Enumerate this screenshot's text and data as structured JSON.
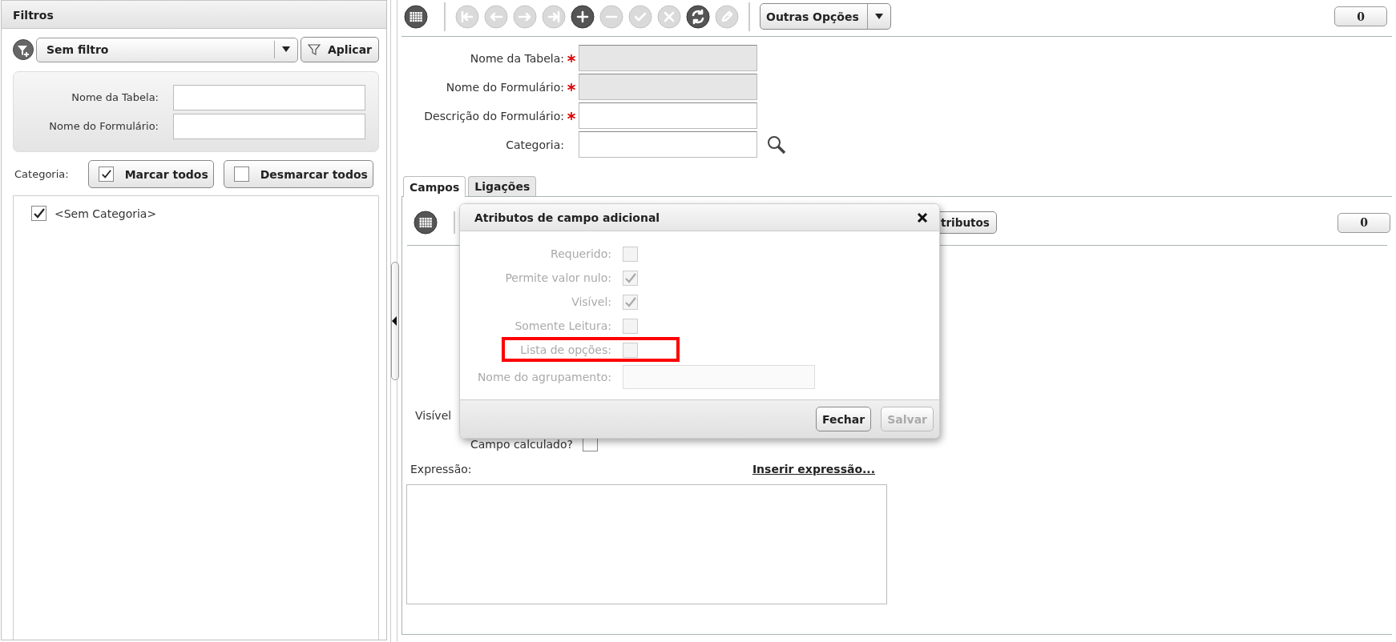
{
  "filters_panel": {
    "title": "Filtros",
    "filter_select": {
      "value": "Sem filtro"
    },
    "apply_button": "Aplicar",
    "fields": [
      {
        "label": "Nome da Tabela:"
      },
      {
        "label": "Nome do Formulário:"
      }
    ],
    "category_label": "Categoria:",
    "check_all_button": "Marcar todos",
    "uncheck_all_button": "Desmarcar todos",
    "categories": [
      {
        "label": "<Sem Categoria>",
        "checked": true
      }
    ]
  },
  "toolbar": {
    "buttons": [
      {
        "kind": "first",
        "disabled": true
      },
      {
        "kind": "prev",
        "disabled": true
      },
      {
        "kind": "next",
        "disabled": true
      },
      {
        "kind": "last",
        "disabled": true
      },
      {
        "kind": "add",
        "disabled": false
      },
      {
        "kind": "remove",
        "disabled": true
      },
      {
        "kind": "confirm",
        "disabled": true
      },
      {
        "kind": "cancel",
        "disabled": true
      },
      {
        "kind": "refresh",
        "disabled": false
      },
      {
        "kind": "edit",
        "disabled": true
      }
    ],
    "more_options_button": "Outras Opções",
    "counter": "0"
  },
  "form": {
    "fields": [
      {
        "label": "Nome da Tabela:",
        "required": true,
        "disabled": true,
        "lookup": false
      },
      {
        "label": "Nome do Formulário:",
        "required": true,
        "disabled": true,
        "lookup": false
      },
      {
        "label": "Descrição do Formulário:",
        "required": true,
        "disabled": false,
        "lookup": false
      },
      {
        "label": "Categoria:",
        "required": false,
        "disabled": false,
        "lookup": true
      }
    ]
  },
  "tabs": [
    {
      "label": "Campos",
      "selected": true
    },
    {
      "label": "Ligações",
      "selected": false
    }
  ],
  "fields_tab": {
    "attributes_button": "tributos",
    "counter": "0",
    "visible_label": "Visível",
    "calculated_label": "Campo calculado?",
    "calculated_checked": false,
    "expression_label": "Expressão:",
    "insert_expression_link": "Inserir expressão..."
  },
  "dialog": {
    "title": "Atributos de campo adicional",
    "rows": [
      {
        "kind": "checkbox",
        "label": "Requerido:",
        "checked": false,
        "disabled": true,
        "highlighted": false
      },
      {
        "kind": "checkbox",
        "label": "Permite valor nulo:",
        "checked": true,
        "disabled": true,
        "highlighted": false
      },
      {
        "kind": "checkbox",
        "label": "Visível:",
        "checked": true,
        "disabled": true,
        "highlighted": false
      },
      {
        "kind": "checkbox",
        "label": "Somente Leitura:",
        "checked": false,
        "disabled": true,
        "highlighted": false
      },
      {
        "kind": "checkbox",
        "label": "Lista de opções:",
        "checked": false,
        "disabled": true,
        "highlighted": true
      },
      {
        "kind": "text",
        "label": "Nome do agrupamento:",
        "disabled": true,
        "highlighted": false
      }
    ],
    "buttons": [
      {
        "label": "Fechar",
        "disabled": false
      },
      {
        "label": "Salvar",
        "disabled": true
      }
    ]
  }
}
